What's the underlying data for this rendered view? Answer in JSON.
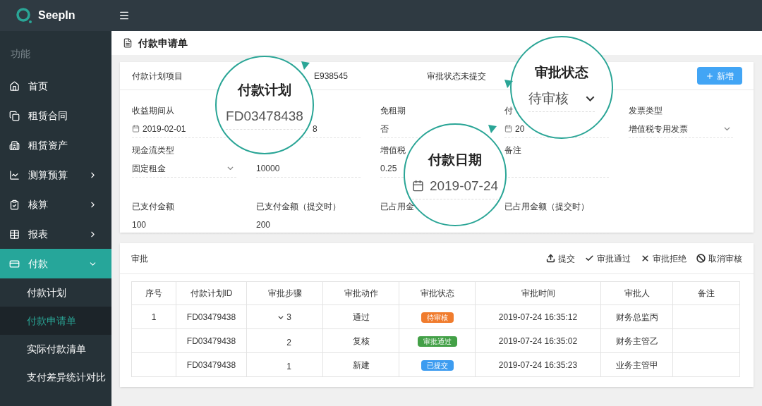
{
  "brand": "SeepIn",
  "sidebar": {
    "section": "功能",
    "items": [
      {
        "label": "首页",
        "selected": false
      },
      {
        "label": "租赁合同",
        "selected": false
      },
      {
        "label": "租赁资产",
        "selected": false
      },
      {
        "label": "测算预算",
        "selected": false,
        "expanded": false
      },
      {
        "label": "核算",
        "selected": false,
        "expanded": false
      },
      {
        "label": "报表",
        "selected": false,
        "expanded": false
      },
      {
        "label": "付款",
        "selected": true,
        "expanded": true,
        "children": [
          {
            "label": "付款计划",
            "selected": false
          },
          {
            "label": "付款申请单",
            "selected": true
          },
          {
            "label": "实际付款清单",
            "selected": false
          },
          {
            "label": "支付差异统计对比",
            "selected": false
          }
        ]
      }
    ]
  },
  "page_title": "付款申请单",
  "form": {
    "top": {
      "label": "付款计划项目",
      "value": "E938545",
      "status": "审批状态未提交",
      "add_button": "新增"
    },
    "rows": [
      [
        {
          "label": "收益期间从",
          "value": "2019-02-01",
          "kind": "date"
        },
        {
          "value": "8",
          "kind": "text"
        },
        {
          "label": "免租期",
          "value": "否",
          "kind": "text"
        },
        {
          "label": "付",
          "value": "20",
          "kind": "date"
        },
        {
          "label": "发票类型",
          "value": "增值税专用发票",
          "kind": "select"
        }
      ],
      [
        {
          "label": "现金流类型",
          "value": "固定租金",
          "kind": "select"
        },
        {
          "value": "10000",
          "kind": "text"
        },
        {
          "label": "增值税",
          "value": "0.25",
          "kind": "text"
        },
        {
          "label": "备注",
          "kind": "text"
        }
      ],
      [
        {
          "label": "已支付金额",
          "value": "100",
          "kind": "text"
        },
        {
          "label": "已支付金额（提交时）",
          "value": "200",
          "kind": "text"
        },
        {
          "label": "已占用金",
          "kind": "text"
        },
        {
          "label": "已占用金额（提交时）",
          "kind": "text"
        }
      ]
    ]
  },
  "callouts": [
    {
      "title": "付款计划",
      "value": "FD03478438",
      "kind": "text"
    },
    {
      "title": "审批状态",
      "value": "待审核",
      "kind": "select"
    },
    {
      "title": "付款日期",
      "value": "2019-07-24",
      "kind": "date"
    }
  ],
  "approval": {
    "title": "审批",
    "actions": [
      {
        "label": "提交"
      },
      {
        "label": "审批通过"
      },
      {
        "label": "审批拒绝"
      },
      {
        "label": "取消审核"
      }
    ],
    "table": {
      "columns": [
        "序号",
        "付款计划ID",
        "审批步骤",
        "审批动作",
        "审批状态",
        "审批时间",
        "审批人",
        "备注"
      ],
      "rows": [
        {
          "index": "1",
          "id": "FD03479438",
          "step": "3",
          "expanded": true,
          "action": "通过",
          "status": "待审核",
          "color": "#f07c2e",
          "time": "2019-07-24 16:35:12",
          "person": "财务总监丙"
        },
        {
          "id": "FD03479438",
          "step": "2",
          "expanded": false,
          "action": "复核",
          "status": "审批通过",
          "color": "#43a047",
          "time": "2019-07-24 16:35:02",
          "person": "财务主管乙"
        },
        {
          "id": "FD03479438",
          "step": "1",
          "expanded": false,
          "action": "新建",
          "status": "已提交",
          "color": "#3d9cf0",
          "time": "2019-07-24 16:35:23",
          "person": "业务主管甲"
        }
      ]
    }
  }
}
